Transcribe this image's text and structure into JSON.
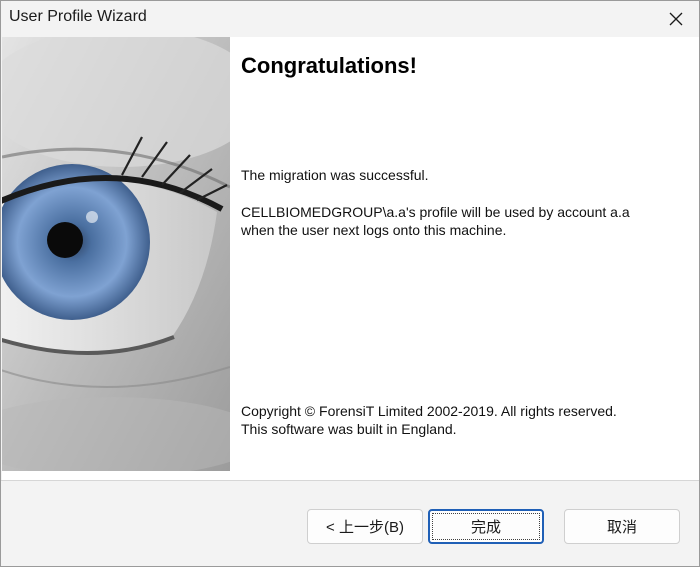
{
  "window": {
    "title": "User Profile Wizard",
    "close_icon": "close-icon"
  },
  "main": {
    "heading": "Congratulations!",
    "message_success": "The migration was successful.",
    "message_profile": "CELLBIOMEDGROUP\\a.a's profile will be used by account a.a when the user next logs onto this machine.",
    "copyright_line1": "Copyright © ForensiT Limited 2002-2019. All rights reserved.",
    "copyright_line2": "This software was built in England."
  },
  "buttons": {
    "back_label": "< 上一步(B)",
    "finish_label": "完成",
    "cancel_label": "取消"
  },
  "colors": {
    "accent_border": "#1f5fb6",
    "iris": "#6f93c6"
  }
}
